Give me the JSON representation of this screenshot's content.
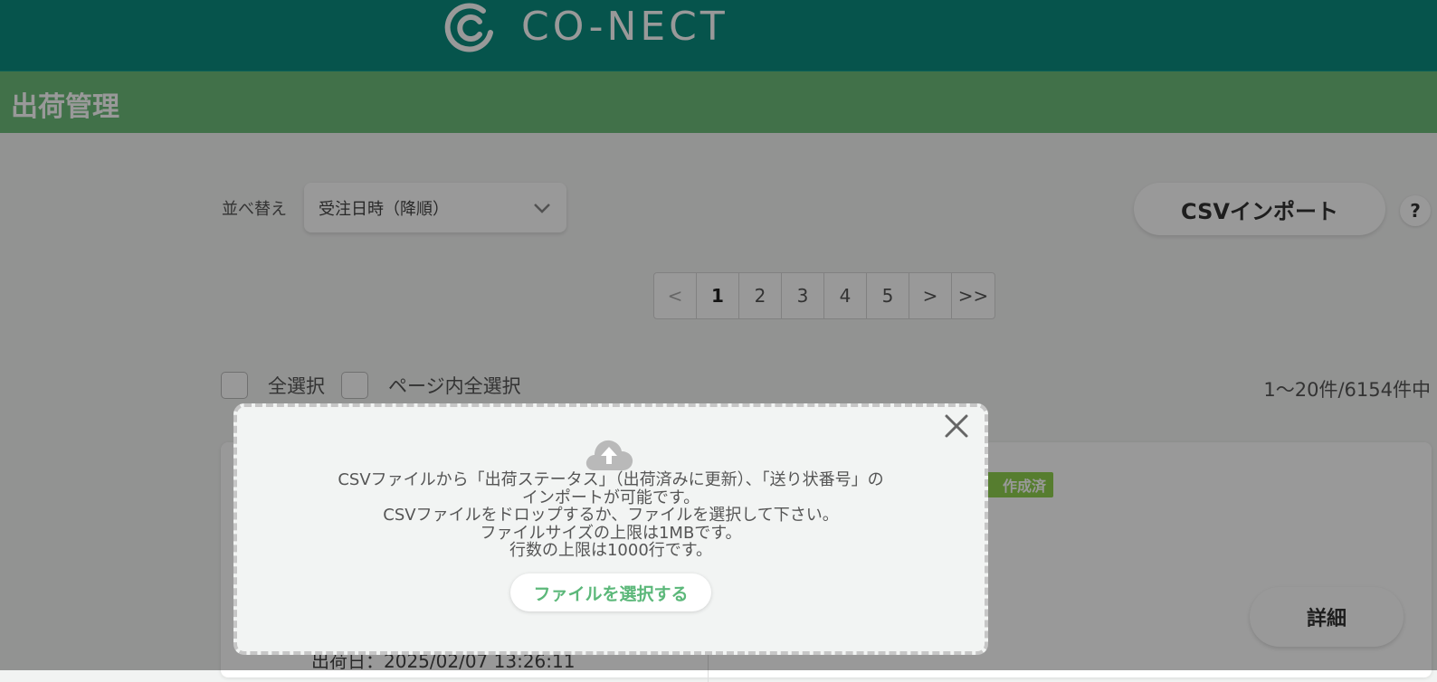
{
  "header": {
    "logo_text": "CO-NECT"
  },
  "page": {
    "title": "出荷管理"
  },
  "sort": {
    "label": "並べ替え",
    "selected": "受注日時（降順）"
  },
  "csv_import": {
    "label": "CSVインポート",
    "help": "?"
  },
  "pagination": {
    "items": [
      "<",
      "1",
      "2",
      "3",
      "4",
      "5",
      ">",
      ">>"
    ],
    "active": "1"
  },
  "selection": {
    "select_all": "全選択",
    "select_page": "ページ内全選択",
    "count": "1～20件/6154件中"
  },
  "card": {
    "badge": "作成済",
    "ship_date": "出荷日：2025/02/07 13:26:11",
    "detail": "詳細"
  },
  "modal": {
    "lines": [
      "CSVファイルから「出荷ステータス」（出荷済みに更新）、「送り状番号」の",
      "インポートが可能です。",
      "CSVファイルをドロップするか、ファイルを選択して下さい。",
      "ファイルサイズの上限は1MBです。",
      "行数の上限は1000行です。"
    ],
    "file_button": "ファイルを選択する"
  },
  "colors": {
    "header": "#0a8c7f",
    "title_bar": "#6dbd7b",
    "accent_green": "#5cb87a",
    "badge": "#8fd14f"
  }
}
